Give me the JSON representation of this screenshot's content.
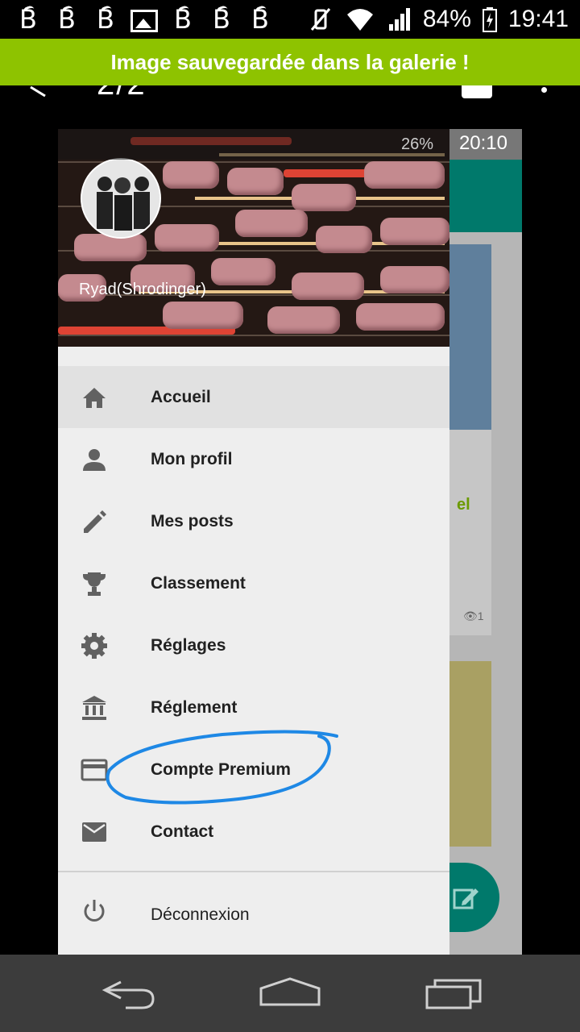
{
  "status_bar": {
    "battery": "84%",
    "time": "19:41"
  },
  "toast": {
    "message": "Image sauvegardée dans la galerie !"
  },
  "viewer": {
    "counter": "2/2"
  },
  "inner_status": {
    "battery": "26%",
    "time": "20:10"
  },
  "drawer": {
    "username": "Ryad(Shrodinger)",
    "items": [
      {
        "label": "Accueil",
        "icon": "home-icon",
        "active": true
      },
      {
        "label": "Mon profil",
        "icon": "person-icon"
      },
      {
        "label": "Mes posts",
        "icon": "pencil-icon"
      },
      {
        "label": "Classement",
        "icon": "trophy-icon"
      },
      {
        "label": "Réglages",
        "icon": "gear-icon"
      },
      {
        "label": "Réglement",
        "icon": "bank-icon"
      },
      {
        "label": "Compte Premium",
        "icon": "credit-card-icon"
      },
      {
        "label": "Contact",
        "icon": "mail-icon"
      }
    ],
    "logout": {
      "label": "Déconnexion",
      "icon": "power-icon"
    }
  },
  "behind_content": {
    "green_text": "el",
    "views": "1"
  },
  "colors": {
    "toast": "#8ec300",
    "teal": "#00796b",
    "annotation": "#1e88e5"
  }
}
